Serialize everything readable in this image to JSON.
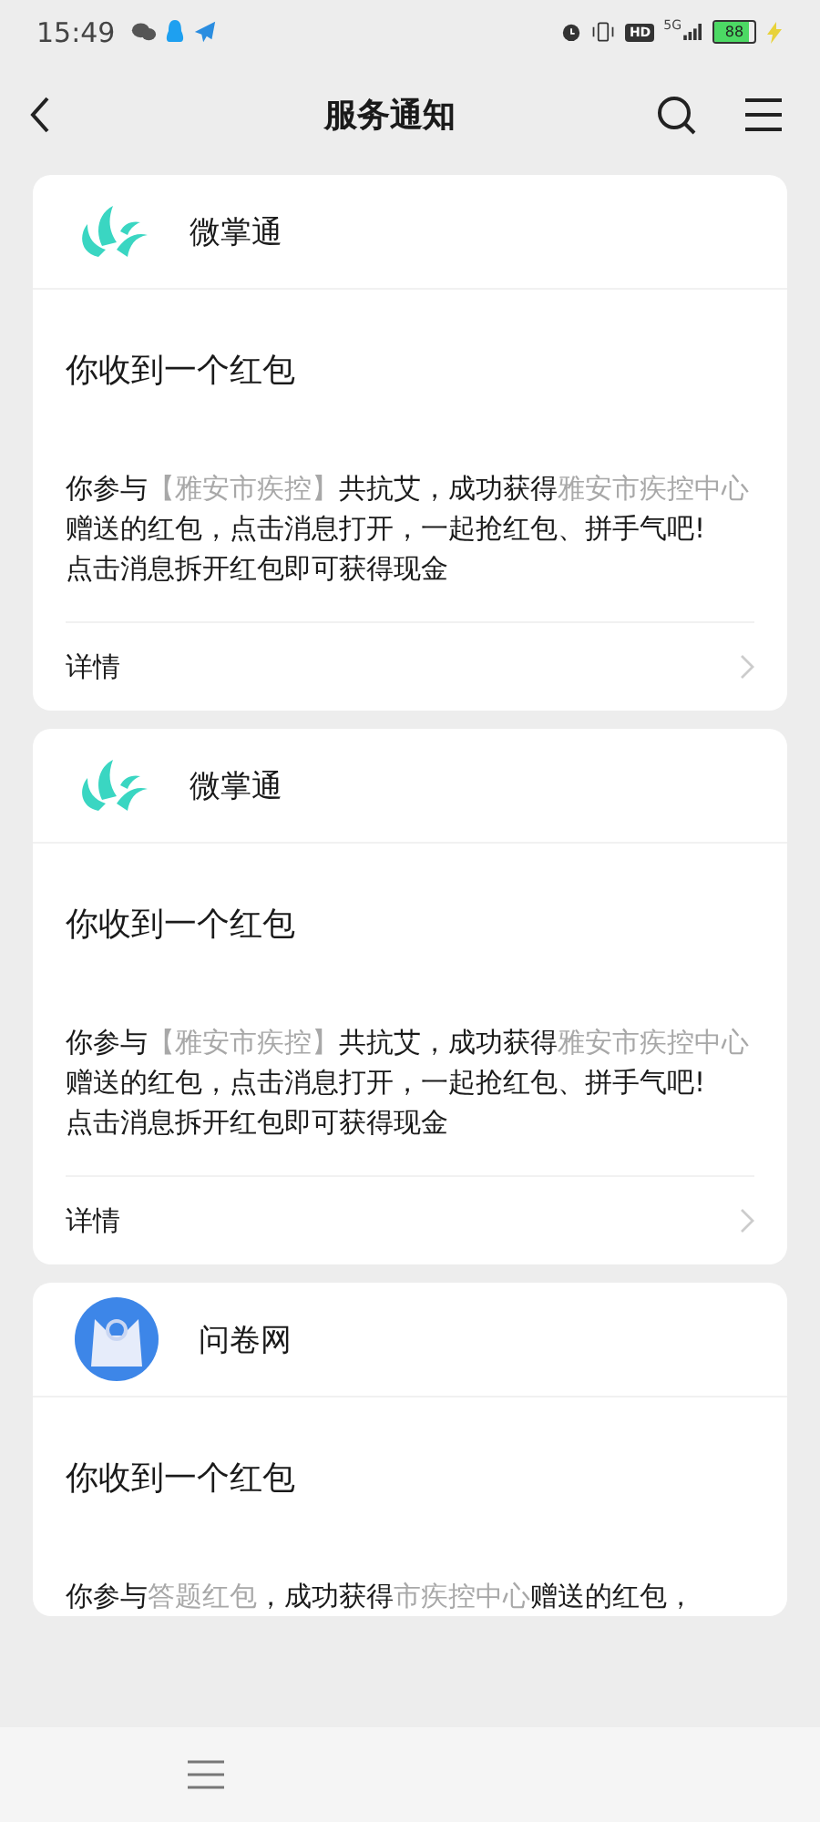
{
  "status_bar": {
    "time": "15:49",
    "network": "5G",
    "hd": "HD",
    "battery": "88",
    "charging": true
  },
  "header": {
    "title": "服务通知"
  },
  "cards": [
    {
      "sender": "微掌通",
      "kind": "swirl",
      "title": "你收到一个红包",
      "body": [
        {
          "text": "你参与",
          "highlight": false
        },
        {
          "text": "【雅安市疾控】",
          "highlight": true
        },
        {
          "text": "共抗艾，成功获得",
          "highlight": false
        },
        {
          "text": "雅安市疾控中心",
          "highlight": true
        },
        {
          "text": "赠送的红包，点击消息打开，一起抢红包、拼手气吧!",
          "highlight": false
        }
      ],
      "note": "点击消息拆开红包即可获得现金",
      "details": "详情"
    },
    {
      "sender": "微掌通",
      "kind": "swirl",
      "title": "你收到一个红包",
      "body": [
        {
          "text": "你参与",
          "highlight": false
        },
        {
          "text": "【雅安市疾控】",
          "highlight": true
        },
        {
          "text": "共抗艾，成功获得",
          "highlight": false
        },
        {
          "text": "雅安市疾控中心",
          "highlight": true
        },
        {
          "text": "赠送的红包，点击消息打开，一起抢红包、拼手气吧!",
          "highlight": false
        }
      ],
      "note": "点击消息拆开红包即可获得现金",
      "details": "详情"
    },
    {
      "sender": "问卷网",
      "kind": "round",
      "title": "你收到一个红包",
      "body": [
        {
          "text": "你参与",
          "highlight": false
        },
        {
          "text": "答题红包",
          "highlight": true
        },
        {
          "text": "，成功获得",
          "highlight": false
        },
        {
          "text": "市疾控中心",
          "highlight": true
        },
        {
          "text": "赠送的红包，",
          "highlight": false
        }
      ]
    }
  ]
}
